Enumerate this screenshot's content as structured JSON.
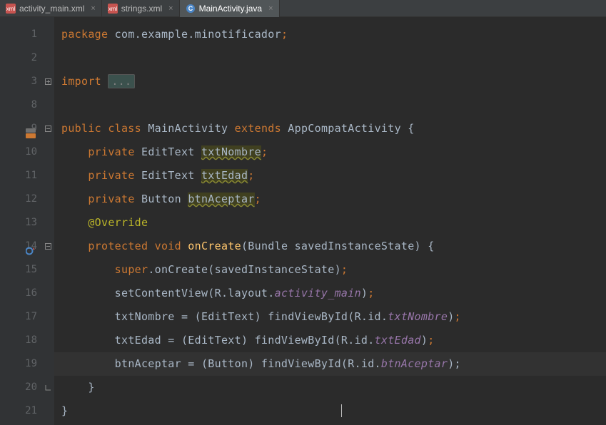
{
  "tabs": [
    {
      "label": "activity_main.xml",
      "icon": "xml",
      "active": false
    },
    {
      "label": "strings.xml",
      "icon": "xml",
      "active": false
    },
    {
      "label": "MainActivity.java",
      "icon": "java",
      "active": true
    }
  ],
  "line_numbers": [
    "1",
    "2",
    "3",
    "8",
    "9",
    "10",
    "11",
    "12",
    "13",
    "14",
    "15",
    "16",
    "17",
    "18",
    "19",
    "20",
    "21"
  ],
  "code": {
    "l1_package": "package",
    "l1_pkg_name": " com.example.minotificador",
    "l1_semi": ";",
    "l3_import": "import",
    "l3_ell": "...",
    "l9_public": "public class",
    "l9_name": " MainActivity ",
    "l9_extends": "extends",
    "l9_super": " AppCompatActivity {",
    "priv": "private",
    "et": " EditText ",
    "btn_t": " Button ",
    "f1": "txtNombre",
    "f2": "txtEdad",
    "f3": "btnAceptar",
    "semi": ";",
    "l13_override": "@Override",
    "l14_protected": "protected void",
    "l14_onCreate": " onCreate",
    "l14_args": "(Bundle savedInstanceState) {",
    "l15_super": "super",
    "l15_call": ".onCreate(savedInstanceState)",
    "l16_scv": "setContentView(R.layout.",
    "l16_am": "activity_main",
    "l16_close": ")",
    "l17_a": "txtNombre = (EditText) findViewById(R.id.",
    "l17_f": "txtNombre",
    "l18_a": "txtEdad = (EditText) findViewById(R.id.",
    "l18_f": "txtEdad",
    "l19_a": "btnAceptar = (Button) findViewById(R.id.",
    "l19_f": "btnAceptar",
    "close_paren_semi": ");",
    "close_brace": "}"
  }
}
